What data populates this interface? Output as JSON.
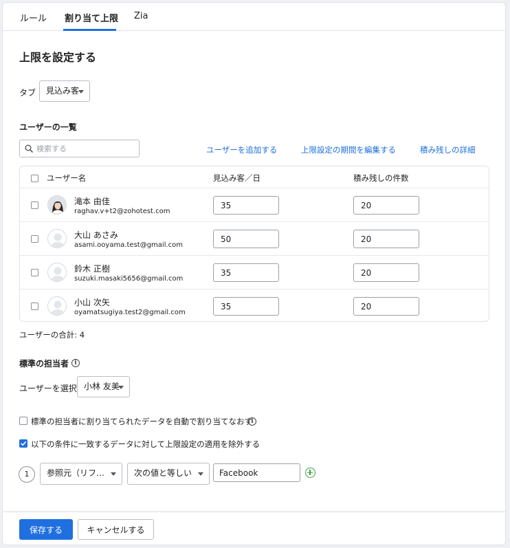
{
  "tabs": [
    {
      "label": "ルール"
    },
    {
      "label": "割り当て上限"
    },
    {
      "label": "Zia"
    }
  ],
  "page_title": "上限を設定する",
  "tab_filter": {
    "label": "タブ",
    "value": "見込み客"
  },
  "user_list": {
    "heading": "ユーザーの一覧",
    "search_placeholder": "検索する",
    "links": {
      "add_user": "ユーザーを追加する",
      "edit_period": "上限設定の期間を編集する",
      "backlog_details": "積み残しの詳細"
    },
    "columns": {
      "user": "ユーザー名",
      "per_day": "見込み客／日",
      "backlog": "積み残しの件数"
    },
    "rows": [
      {
        "name": "滝本 由佳",
        "email": "raghav.v+t2@zohotest.com",
        "per_day": "35",
        "backlog": "20",
        "avatar": "photo"
      },
      {
        "name": "大山 あさみ",
        "email": "asami.ooyama.test@gmail.com",
        "per_day": "50",
        "backlog": "20",
        "avatar": "placeholder-avatar-icon"
      },
      {
        "name": "鈴木 正樹",
        "email": "suzuki.masaki5656@gmail.com",
        "per_day": "35",
        "backlog": "20",
        "avatar": "placeholder-avatar-icon"
      },
      {
        "name": "小山 次矢",
        "email": "oyamatsugiya.test2@gmail.com",
        "per_day": "35",
        "backlog": "20",
        "avatar": "placeholder-avatar-icon"
      }
    ],
    "total": "ユーザーの合計: 4"
  },
  "default_owner": {
    "heading": "標準の担当者",
    "select_label": "ユーザーを選択",
    "selected_user": "小林 友美",
    "auto_reassign_label": "標準の担当者に割り当てられたデータを自動で割り当てなおす",
    "auto_reassign_checked": false,
    "exclude_label": "以下の条件に一致するデータに対して上限設定の適用を除外する",
    "exclude_checked": true
  },
  "condition": {
    "index": "1",
    "field": "参照元（リフ…",
    "operator": "次の値と等しい",
    "value": "Facebook"
  },
  "footer": {
    "save": "保存する",
    "cancel": "キャンセルする"
  },
  "colors": {
    "accent": "#1f6fe0",
    "add_green": "#3aa141"
  }
}
